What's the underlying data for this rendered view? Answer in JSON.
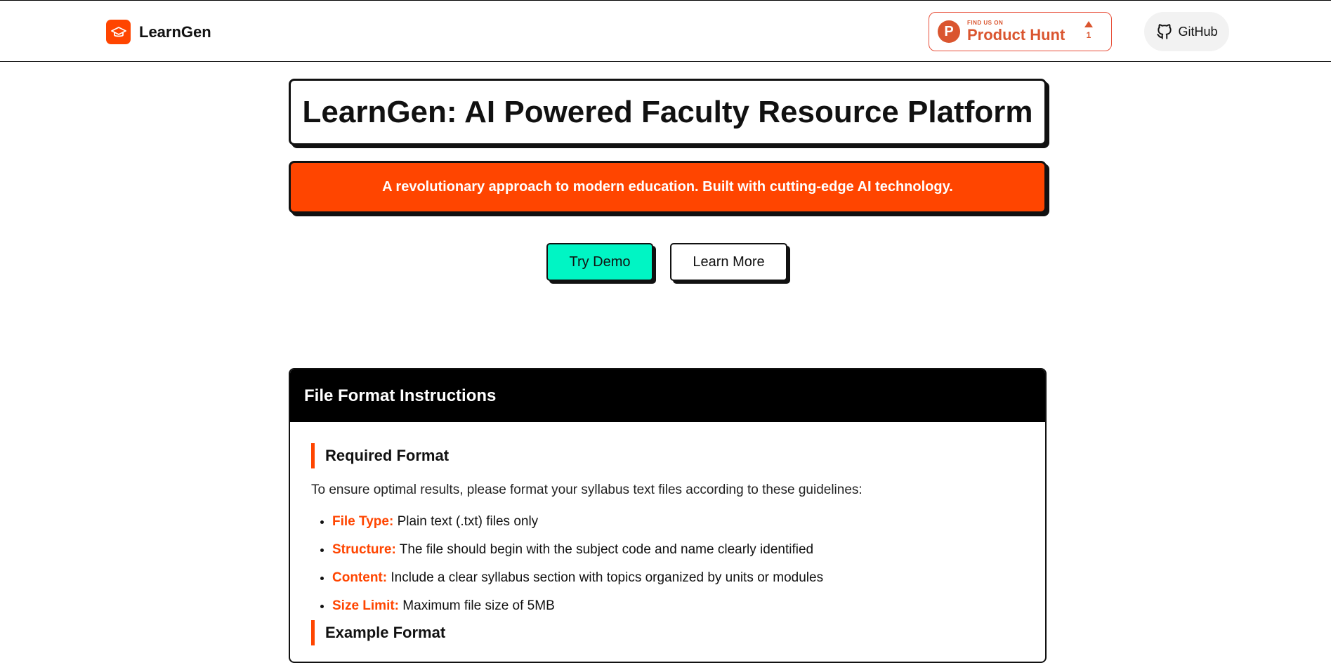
{
  "header": {
    "brand_name": "LearnGen",
    "product_hunt": {
      "small": "FIND US ON",
      "big": "Product Hunt",
      "votes": "1"
    },
    "github_label": "GitHub"
  },
  "hero": {
    "title": "LearnGen: AI Powered Faculty Resource Platform",
    "tagline": "A revolutionary approach to modern education. Built with cutting-edge AI technology.",
    "try_demo": "Try Demo",
    "learn_more": "Learn More"
  },
  "instructions": {
    "header": "File Format Instructions",
    "required_title": "Required Format",
    "intro": "To ensure optimal results, please format your syllabus text files according to these guidelines:",
    "items": [
      {
        "key": "File Type:",
        "text": "Plain text (.txt) files only"
      },
      {
        "key": "Structure:",
        "text": "The file should begin with the subject code and name clearly identified"
      },
      {
        "key": "Content:",
        "text": "Include a clear syllabus section with topics organized by units or modules"
      },
      {
        "key": "Size Limit:",
        "text": "Maximum file size of 5MB"
      }
    ],
    "example_title": "Example Format"
  },
  "colors": {
    "accent": "#ff4500",
    "demo": "#00f5c4",
    "product_hunt": "#da552f"
  }
}
